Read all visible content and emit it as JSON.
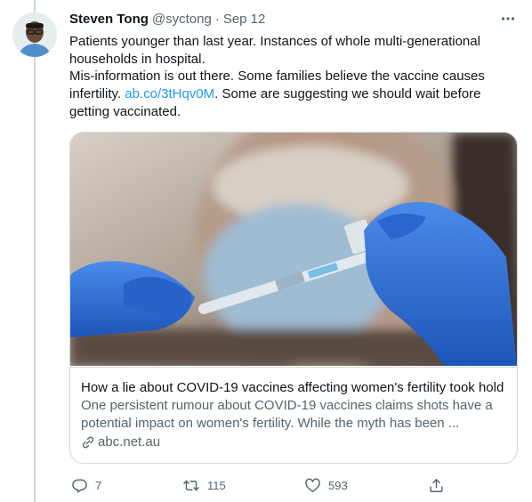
{
  "tweet": {
    "author": {
      "name": "Steven Tong",
      "handle": "@syctong",
      "separator": "·",
      "date": "Sep 12"
    },
    "text_lines": [
      "Patients younger than last year. Instances of whole multi-generational households in hospital.",
      "Mis-information is out there. Some families believe the vaccine causes infertility."
    ],
    "link_text": "ab.co/3tHqv0M",
    "text_after_link": ". Some are suggesting we should wait before getting vaccinated.",
    "card": {
      "title": "How a lie about COVID-19 vaccines affecting women's fertility took hold",
      "description": "One persistent rumour about COVID-19 vaccines claims shots have a potential impact on women's fertility. While the myth has been ...",
      "domain": "abc.net.au"
    },
    "actions": {
      "reply_count": "7",
      "retweet_count": "115",
      "like_count": "593"
    }
  },
  "colors": {
    "text": "#0f1419",
    "secondary": "#536471",
    "link": "#1d9bf0",
    "border": "#cfd9de",
    "glove": "#2f6fd6"
  },
  "icons": {
    "more": "more-horizontal-icon",
    "reply": "reply-icon",
    "retweet": "retweet-icon",
    "like": "like-icon",
    "share": "share-icon",
    "link": "link-icon"
  }
}
